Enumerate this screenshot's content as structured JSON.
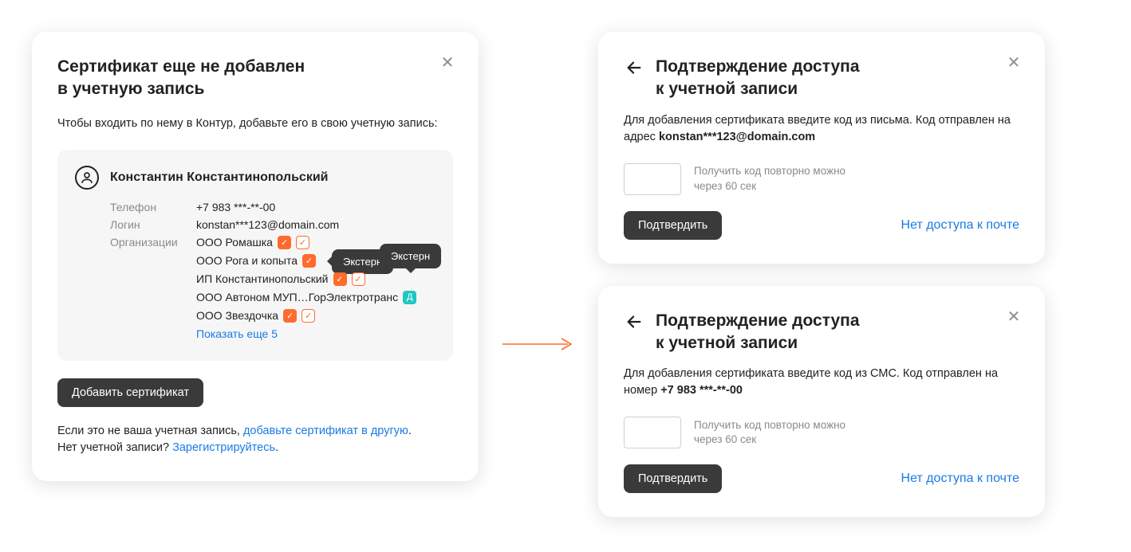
{
  "left_card": {
    "title_line1": "Сертификат еще не добавлен",
    "title_line2": "в учетную запись",
    "subtitle": "Чтобы входить по нему в Контур, добавьте его в свою учетную запись:",
    "profile": {
      "name": "Константин Константинопольский",
      "phone_label": "Телефон",
      "phone_value": "+7 983 ***-**-00",
      "login_label": "Логин",
      "login_value": "konstan***123@domain.com",
      "orgs_label": "Организации",
      "orgs": [
        {
          "name": "ООО Ромашка",
          "badges": [
            "orange",
            "orange-outline"
          ]
        },
        {
          "name": "ООО Рога и копыта",
          "badges": [
            "orange"
          ],
          "tooltip": "Экстерн"
        },
        {
          "name": "ИП Константинопольский",
          "badges": [
            "orange",
            "orange-outline"
          ],
          "tooltip2": "Экстерн"
        },
        {
          "name": "ООО Автоном МУП…ГорЭлектротранс",
          "badges": [
            "teal"
          ]
        },
        {
          "name": "ООО  Звездочка",
          "badges": [
            "orange",
            "orange-outline"
          ]
        }
      ],
      "show_more": "Показать еще 5"
    },
    "add_button": "Добавить сертификат",
    "footer_line1_a": "Если это не ваша учетная запись, ",
    "footer_line1_link": "добавьте сертификат в другую",
    "footer_line1_b": ".",
    "footer_line2_a": "Нет учетной записи?  ",
    "footer_line2_link": "Зарегистрируйтесь",
    "footer_line2_b": "."
  },
  "right_card_email": {
    "title_line1": "Подтверждение доступа",
    "title_line2": "к учетной записи",
    "desc_a": "Для добавления сертификата введите код из письма. Код отправлен на адрес ",
    "desc_bold": "konstan***123@domain.com",
    "retry": "Получить код повторно можно через 60 сек",
    "confirm": "Подтвердить",
    "no_access": "Нет доступа к почте"
  },
  "right_card_sms": {
    "title_line1": "Подтверждение доступа",
    "title_line2": "к учетной записи",
    "desc_a": "Для добавления сертификата введите код из СМС.  Код отправлен на номер ",
    "desc_bold": "+7 983 ***-**-00",
    "retry": "Получить код повторно можно через 60 сек",
    "confirm": "Подтвердить",
    "no_access": "Нет доступа к почте"
  }
}
